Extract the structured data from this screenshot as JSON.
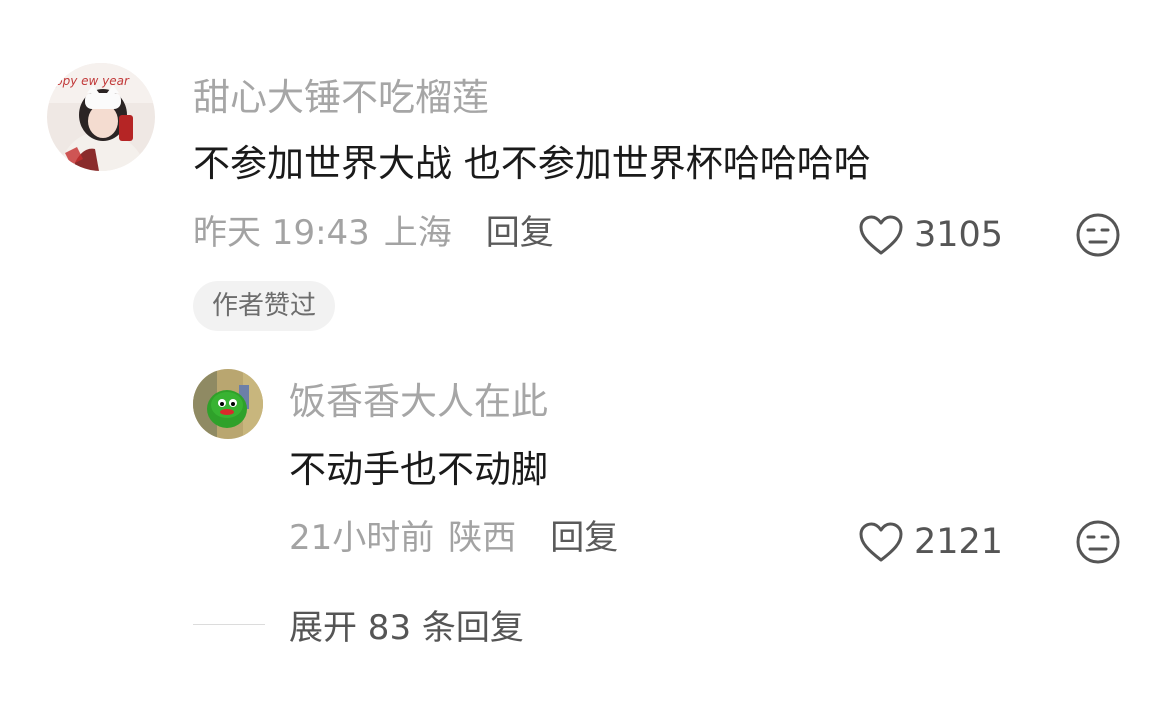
{
  "comments": [
    {
      "username": "甜心大锤不吃榴莲",
      "text": "不参加世界大战 也不参加世界杯哈哈哈哈",
      "time": "昨天 19:43",
      "location": "上海",
      "reply_label": "回复",
      "likes": "3105",
      "badge": "作者赞过",
      "avatar_text": "ppy ew year"
    },
    {
      "username": "饭香香大人在此",
      "text": "不动手也不动脚",
      "time": "21小时前",
      "location": "陕西",
      "reply_label": "回复",
      "likes": "2121"
    }
  ],
  "expand_label": "展开 83 条回复",
  "colors": {
    "username": "#a6a6a6",
    "text": "#1a1a1a",
    "meta": "#a3a3a3",
    "badge_bg": "#f2f2f2"
  },
  "icons": [
    "heart-icon",
    "dislike-face-icon"
  ]
}
